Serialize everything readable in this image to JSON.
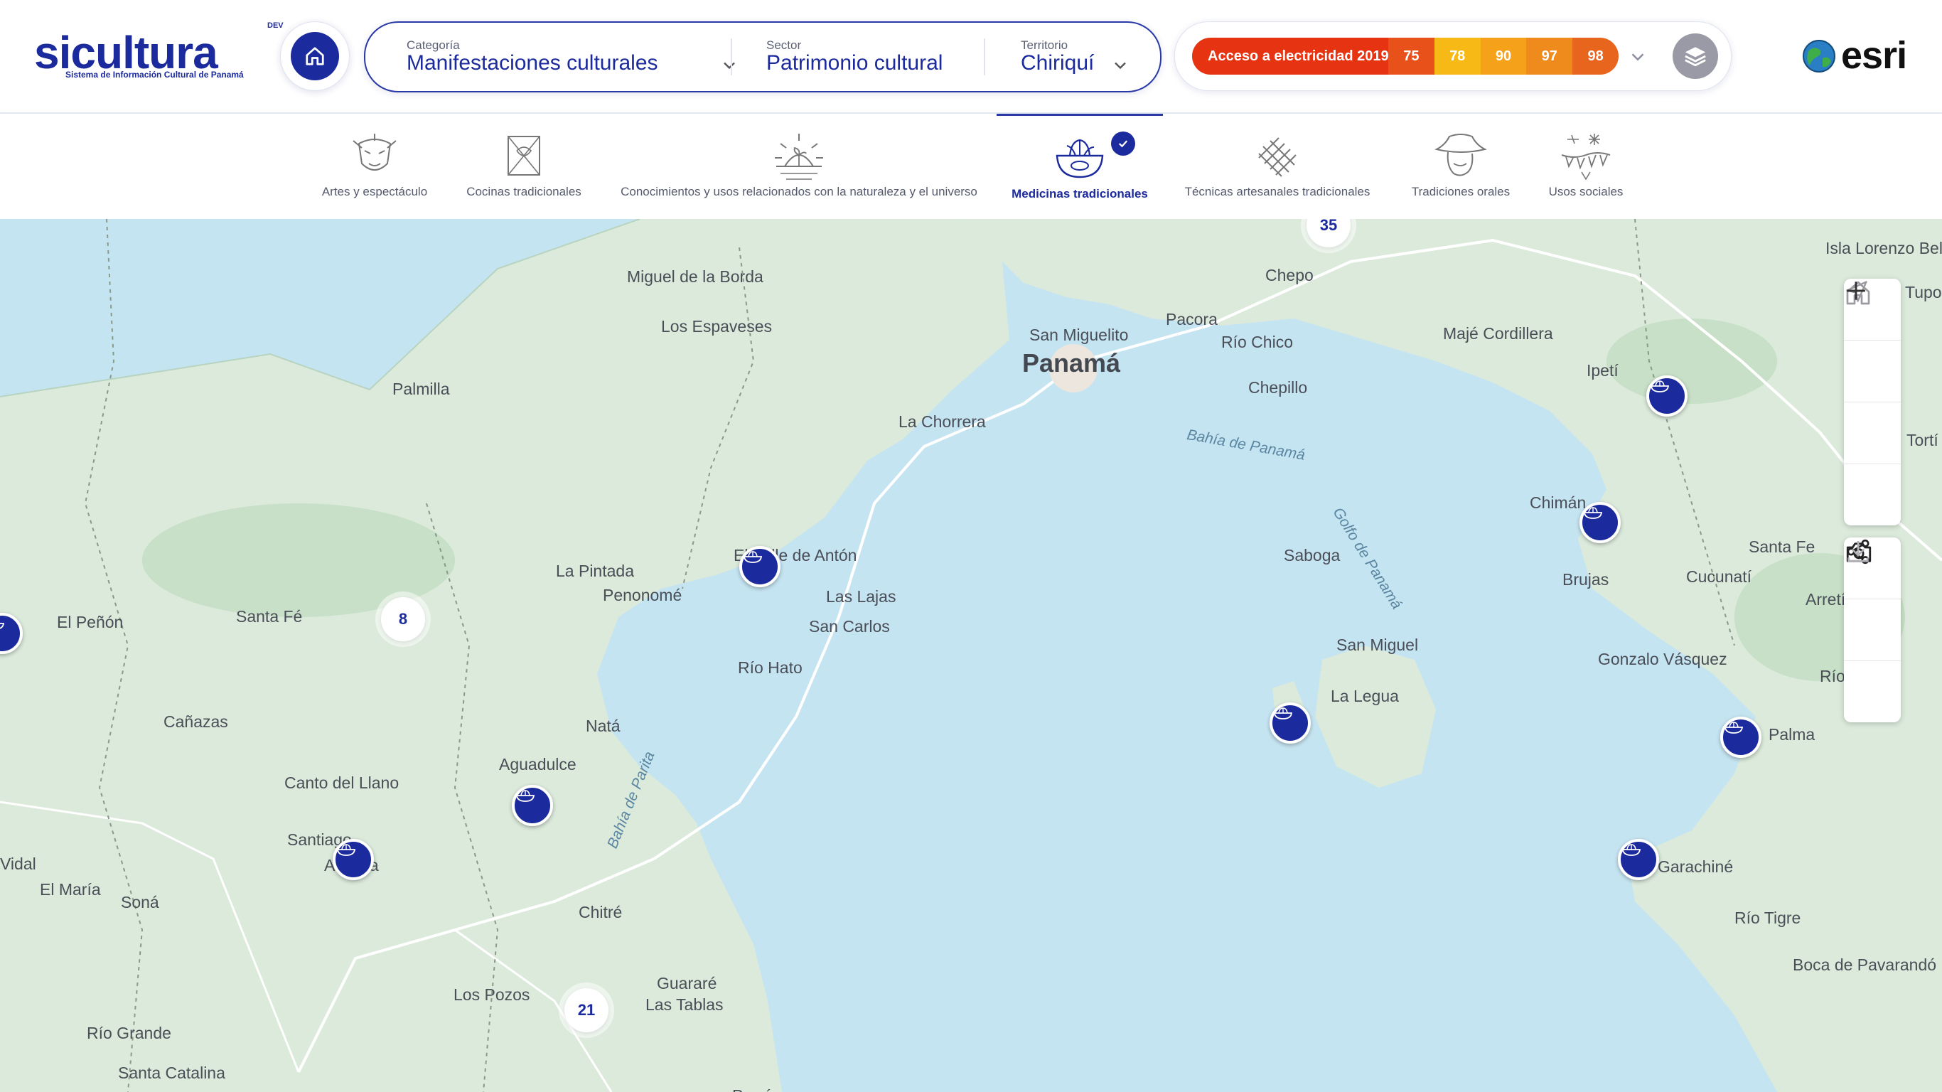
{
  "brand": {
    "name": "sicultura",
    "dev_tag": "DEV",
    "subtitle": "Sistema de Información Cultural de Panamá"
  },
  "filters": {
    "categoria": {
      "label": "Categoría",
      "value": "Manifestaciones culturales"
    },
    "sector": {
      "label": "Sector",
      "value": "Patrimonio cultural"
    },
    "territorio": {
      "label": "Territorio",
      "value": "Chiriquí"
    }
  },
  "legend": {
    "title": "Acceso a electricidad 2019",
    "steps": [
      {
        "label": "75",
        "color": "#e9511b"
      },
      {
        "label": "78",
        "color": "#f7b916"
      },
      {
        "label": "90",
        "color": "#f5a21a"
      },
      {
        "label": "97",
        "color": "#ef8a1c"
      },
      {
        "label": "98",
        "color": "#e8651d"
      }
    ]
  },
  "partner": {
    "name": "esri"
  },
  "tabs": [
    {
      "label": "Artes y espectáculo",
      "icon": "mask-icon",
      "active": false
    },
    {
      "label": "Cocinas tradicionales",
      "icon": "cooking-icon",
      "active": false
    },
    {
      "label": "Conocimientos y usos relacionados con la naturaleza y el universo",
      "icon": "sun-plant-icon",
      "active": false
    },
    {
      "label": "Medicinas tradicionales",
      "icon": "herb-bowl-icon",
      "active": true
    },
    {
      "label": "Técnicas artesanales tradicionales",
      "icon": "weaving-icon",
      "active": false
    },
    {
      "label": "Tradiciones orales",
      "icon": "hat-face-icon",
      "active": false
    },
    {
      "label": "Usos sociales",
      "icon": "celebration-icon",
      "active": false
    }
  ],
  "map": {
    "major_place": "Panamá",
    "places": [
      "Isla Lorenzo Bello",
      "Miguel de la Borda",
      "Chepo",
      "Los Espaveses",
      "San Miguelito",
      "Pacora",
      "Río Chico",
      "Majé Cordillera",
      "Palmilla",
      "La Chorrera",
      "Chepillo",
      "Ipetí",
      "Chimán",
      "Santa Fe",
      "La Pintada",
      "Penonomé",
      "El Valle de Antón",
      "Las Lajas",
      "San Carlos",
      "Río Hato",
      "El Peñón",
      "Santa Fé",
      "Saboga",
      "Brujas",
      "Cucunatí",
      "Arretí",
      "San Miguel",
      "Gonzalo Vásquez",
      "La Legua",
      "Cañazas",
      "Natá",
      "Aguadulce",
      "Canto del Llano",
      "Santiago",
      "Atalaya",
      "Palma",
      "Vidal",
      "El María",
      "Soná",
      "Garachiné",
      "Chitré",
      "Río Tigre",
      "Los Pozos",
      "Guararé",
      "Las Tablas",
      "Boca de Pavarandó",
      "Río Grande",
      "Santa Catalina",
      "Pocrí",
      "Tortí",
      "Río Congo",
      "Tupo"
    ],
    "water_labels": [
      "Bahía de Panamá",
      "Golfo de Panamá",
      "Bahía de Parita"
    ],
    "clusters": [
      "35",
      "8",
      "21"
    ],
    "pin_icon": "herb-bowl-icon"
  },
  "tools": [
    "home-icon",
    "locate-icon",
    "zoom-in-icon",
    "zoom-out-icon",
    "share-icon",
    "camera-icon",
    "download-icon"
  ]
}
